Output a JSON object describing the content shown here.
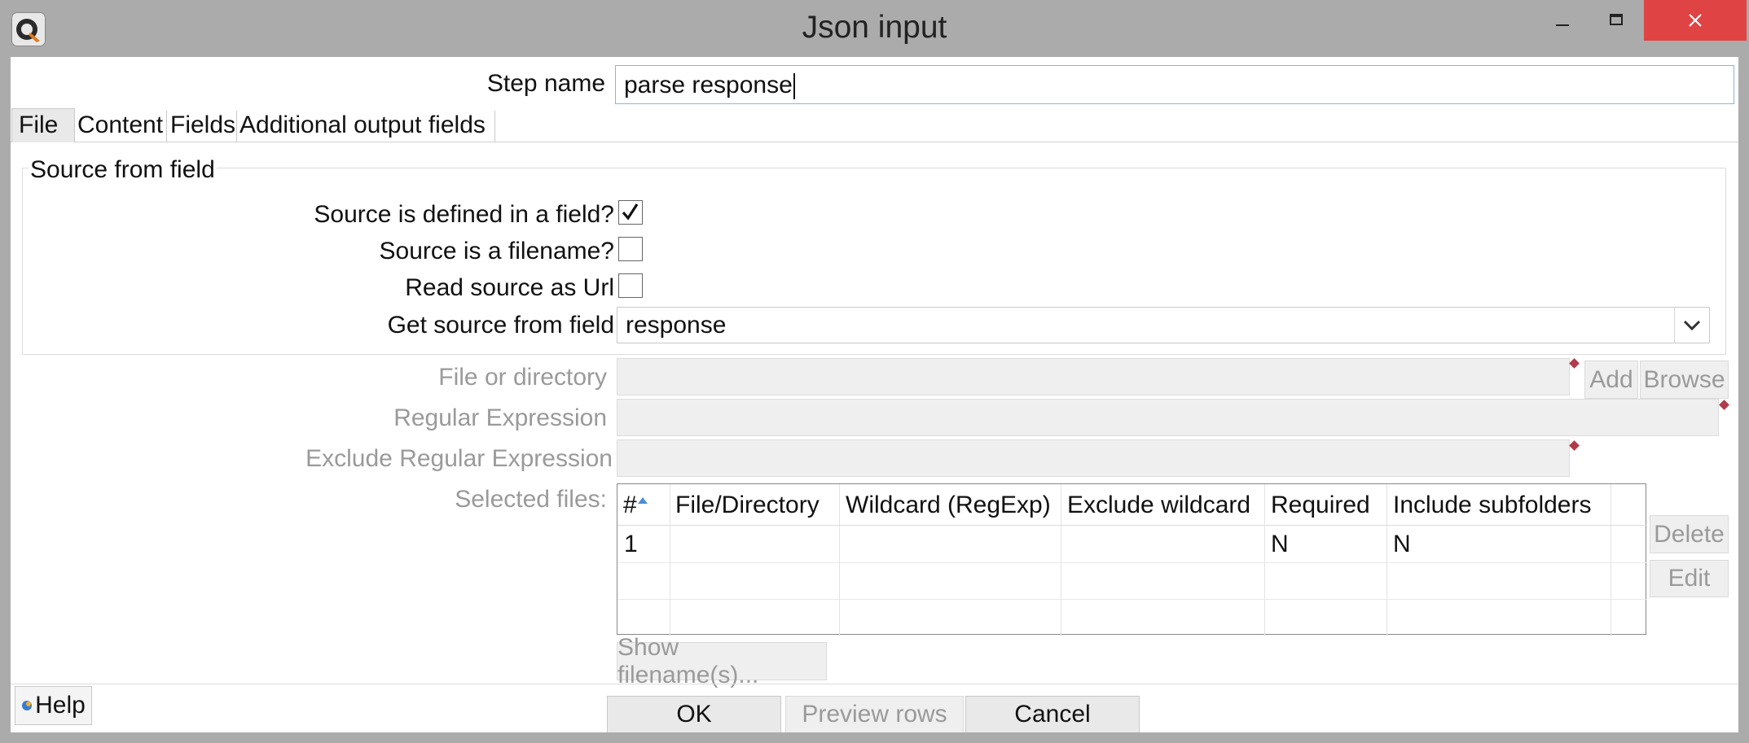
{
  "window": {
    "title": "Json input",
    "minimize_icon": "minimize-icon",
    "maximize_icon": "maximize-icon",
    "close_icon": "close-icon",
    "app_icon": "spoon-app-icon"
  },
  "step_name": {
    "label": "Step name",
    "value": "parse response"
  },
  "tabs": [
    {
      "label": "File"
    },
    {
      "label": "Content"
    },
    {
      "label": "Fields"
    },
    {
      "label": "Additional output fields"
    }
  ],
  "source_group": {
    "title": "Source from field",
    "source_in_field": {
      "label": "Source is defined in a field?",
      "checked": true
    },
    "source_is_filename": {
      "label": "Source is a filename?",
      "checked": false
    },
    "read_as_url": {
      "label": "Read source as Url",
      "checked": false
    },
    "get_source_field": {
      "label": "Get source from field",
      "value": "response"
    }
  },
  "file_section": {
    "file_or_directory_label": "File or directory",
    "add_button": "Add",
    "browse_button": "Browse",
    "regex_label": "Regular Expression",
    "exclude_regex_label": "Exclude Regular Expression",
    "selected_files_label": "Selected files:",
    "columns": [
      "#",
      "File/Directory",
      "Wildcard (RegExp)",
      "Exclude wildcard",
      "Required",
      "Include subfolders"
    ],
    "rows": [
      [
        "1",
        "",
        "",
        "",
        "N",
        "N"
      ]
    ],
    "delete_button": "Delete",
    "edit_button": "Edit",
    "show_filenames_button": "Show filename(s)..."
  },
  "footer": {
    "help_button": "Help",
    "ok_button": "OK",
    "preview_button": "Preview rows",
    "cancel_button": "Cancel"
  },
  "colors": {
    "close_red": "#e04343",
    "accent_border": "#8ab4dc",
    "variable_marker": "#b23a4a"
  }
}
